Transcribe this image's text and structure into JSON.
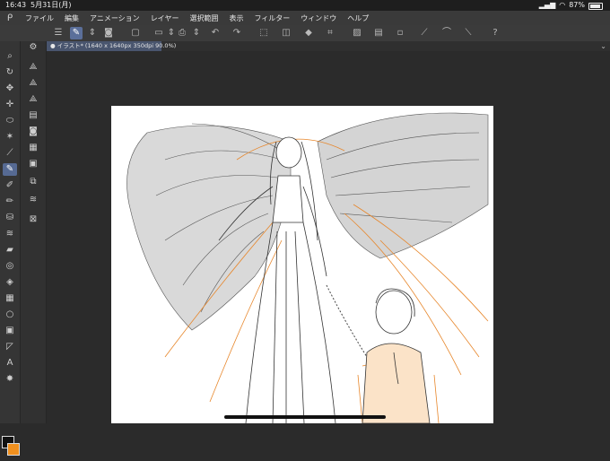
{
  "status": {
    "time": "16:43",
    "date": "5月31日(月)",
    "battery": "87%",
    "battery_level": 0.87
  },
  "menu": [
    "ファイル",
    "編集",
    "アニメーション",
    "レイヤー",
    "選択範囲",
    "表示",
    "フィルター",
    "ウィンドウ",
    "ヘルプ"
  ],
  "toolbar": {
    "items": [
      "menu-icon",
      "pen-icon",
      "updown-icon",
      "camera-icon",
      "new-icon",
      "open-icon",
      "updown-icon",
      "print-icon",
      "updown-icon",
      "undo-icon",
      "redo-icon",
      "select-all-icon",
      "deselect-icon",
      "fill-icon",
      "crop-icon",
      "layer-a-icon",
      "layer-b-icon",
      "layer-c-icon",
      "ruler-a-icon",
      "ruler-b-icon",
      "ruler-c-icon",
      "help-icon"
    ]
  },
  "document": {
    "tab_title": "● イラスト* (1640 x 1640px 350dpi 90.0%)"
  },
  "colors": {
    "main": "#111111",
    "sub": "#f0901e",
    "accent": "#566a93"
  }
}
